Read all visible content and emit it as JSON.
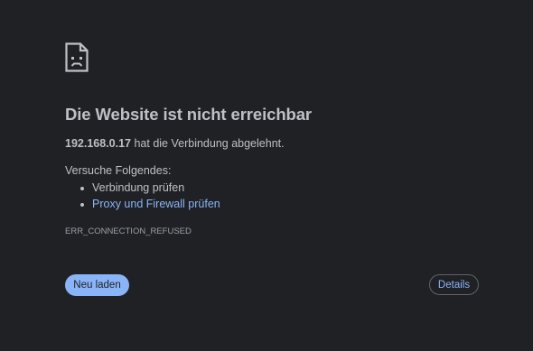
{
  "icon": "sad-page-icon",
  "title": "Die Website ist nicht erreichbar",
  "host": "192.168.0.17",
  "host_suffix": " hat die Verbindung abgelehnt.",
  "try_label": "Versuche Folgendes:",
  "suggestions": [
    {
      "text": "Verbindung prüfen",
      "link": false
    },
    {
      "text": "Proxy und Firewall prüfen",
      "link": true
    }
  ],
  "error_code": "ERR_CONNECTION_REFUSED",
  "buttons": {
    "reload": "Neu laden",
    "details": "Details"
  },
  "colors": {
    "background": "#202124",
    "text": "#bdc1c6",
    "link": "#8ab4f8",
    "primary_button": "#8ab4f8"
  }
}
